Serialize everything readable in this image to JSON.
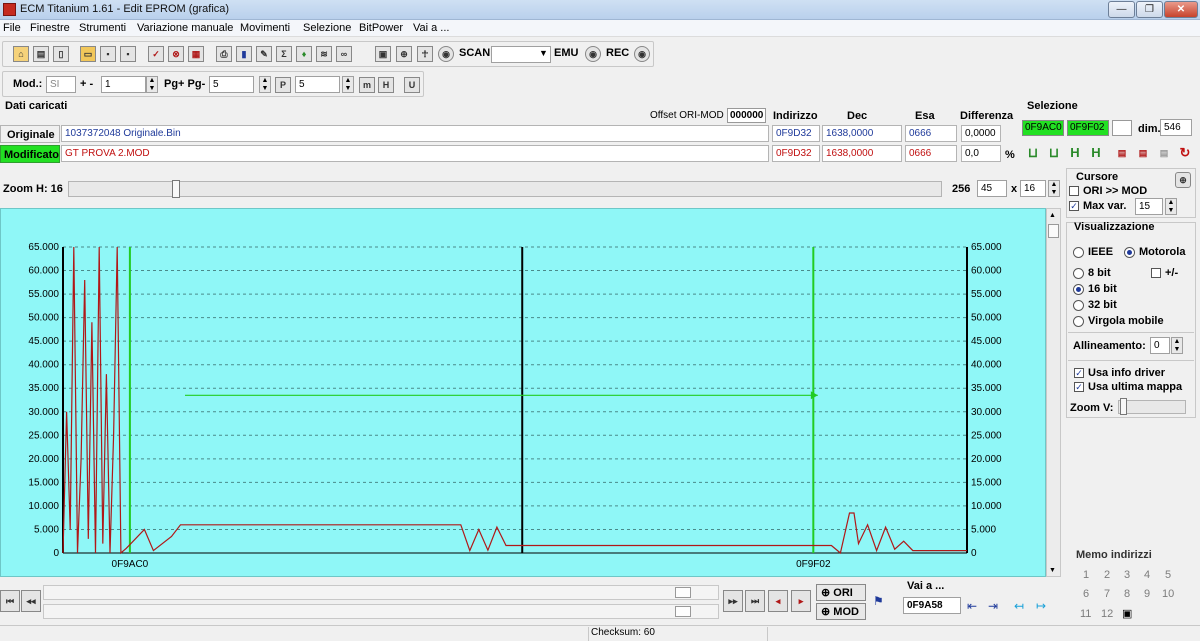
{
  "window": {
    "title": "ECM Titanium 1.61 - Edit EPROM (grafica)",
    "minimize": "—",
    "maximize": "❐",
    "close": "✕"
  },
  "menu": [
    "File",
    "Finestre",
    "Strumenti",
    "Variazione manuale",
    "Movimenti",
    "Selezione",
    "BitPower",
    "Vai a ..."
  ],
  "toolbar": {
    "scan": "SCAN",
    "emu": "EMU",
    "rec": "REC"
  },
  "nav_toolbar": {
    "mod_label": "Mod.:",
    "mod_value": "SI",
    "step_label": "+ -",
    "step_value": "1",
    "page_label": "Pg+ Pg-",
    "page_value": "5",
    "p_value": "5"
  },
  "data_panel": {
    "title": "Dati caricati",
    "offset_label": "Offset ORI-MOD",
    "offset_value": "000000",
    "cols": {
      "address": "Indirizzo",
      "dec": "Dec",
      "hex": "Esa",
      "diff": "Differenza"
    },
    "original": {
      "label": "Originale",
      "file": "1037372048 Originale.Bin",
      "address": "0F9D32",
      "dec": "1638,0000",
      "hex": "0666",
      "diff": "0,0000"
    },
    "modified": {
      "label": "Modificato",
      "file": "GT PROVA 2.MOD",
      "address": "0F9D32",
      "dec": "1638,0000",
      "hex": "0666",
      "diff": "0,0",
      "diff_unit": "%"
    }
  },
  "selection": {
    "title": "Selezione",
    "start": "0F9AC0",
    "end": "0F9F02",
    "dim_label": "dim.",
    "dim_value": "546"
  },
  "zoom": {
    "label": "Zoom H: 16",
    "right_value": "256",
    "cols": "45",
    "times": "x",
    "rows": "16"
  },
  "cursor": {
    "title": "Cursore",
    "ori_mod": "ORI >> MOD",
    "maxvar_label": "Max var.",
    "maxvar_value": "15"
  },
  "visual": {
    "title": "Visualizzazione",
    "ieee": "IEEE",
    "motorola": "Motorola",
    "b8": "8 bit",
    "plusminus": "+/-",
    "b16": "16 bit",
    "b32": "32 bit",
    "float": "Virgola mobile",
    "align_label": "Allineamento:",
    "align_value": "0",
    "driver": "Usa info driver",
    "lastmap": "Usa ultima mappa",
    "zoomv": "Zoom V:"
  },
  "memo": {
    "title": "Memo indirizzi",
    "numbers": [
      "1",
      "2",
      "3",
      "4",
      "5",
      "6",
      "7",
      "8",
      "9",
      "10",
      "11",
      "12"
    ]
  },
  "bottom": {
    "ori": "ORI",
    "mod": "MOD",
    "goto_label": "Vai a ...",
    "goto_value": "0F9A58"
  },
  "status": {
    "checksum": "Checksum: 60"
  },
  "chart_data": {
    "type": "line",
    "ylim": [
      0,
      65000
    ],
    "yticks": [
      "0",
      "5.000",
      "10.000",
      "15.000",
      "20.000",
      "25.000",
      "30.000",
      "35.000",
      "40.000",
      "45.000",
      "50.000",
      "55.000",
      "60.000",
      "65.000"
    ],
    "xticks": [
      "0F9AC0",
      "0F9F02"
    ],
    "series": [
      {
        "color": "#b01818",
        "x": [
          0,
          0.4,
          0.8,
          1.2,
          1.6,
          2,
          2.4,
          2.8,
          3.2,
          3.6,
          4,
          4.4,
          4.8,
          5.2,
          5.6,
          6,
          6.4,
          7,
          9,
          10,
          12,
          13,
          13.5,
          20,
          40,
          44,
          45,
          46,
          47,
          48,
          49,
          60,
          75,
          85,
          86,
          87,
          87.5,
          88,
          89,
          90,
          91,
          92,
          93,
          94,
          100
        ],
        "y": [
          0,
          30000,
          5000,
          65000,
          0,
          20000,
          58000,
          3000,
          49000,
          0,
          65000,
          2000,
          38000,
          0,
          25000,
          65000,
          0,
          1000,
          5000,
          500,
          3500,
          6000,
          6000,
          6000,
          6000,
          6000,
          500,
          5000,
          600,
          5500,
          1600,
          1600,
          1600,
          1600,
          0,
          8500,
          8500,
          2000,
          6000,
          500,
          5500,
          800,
          2500,
          500,
          500
        ]
      },
      {
        "color": "#22cc22",
        "x": [
          13.5,
          83.5
        ],
        "y": [
          33500,
          33500
        ]
      }
    ]
  }
}
